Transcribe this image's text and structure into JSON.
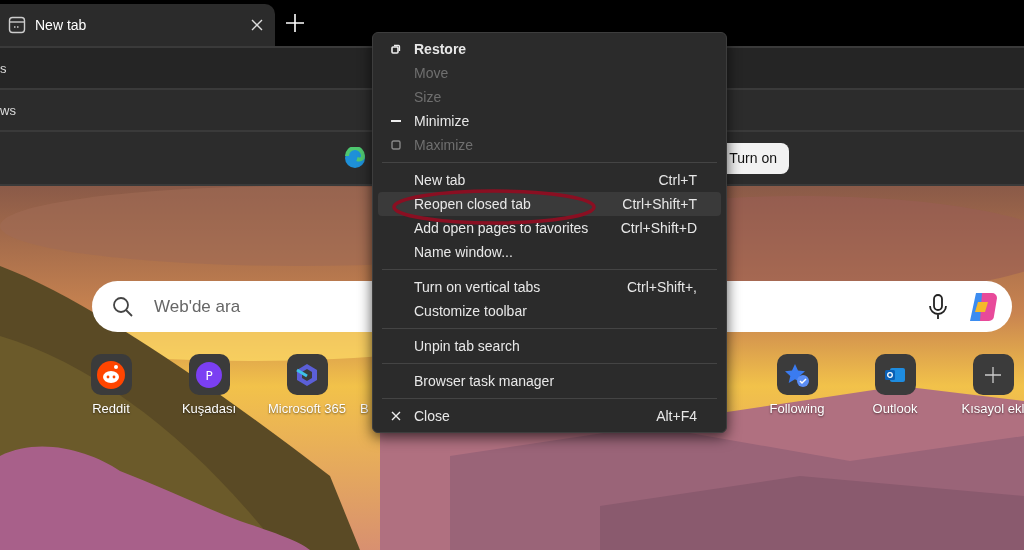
{
  "tabs": [
    {
      "label": "New tab",
      "selected": true
    }
  ],
  "panel": {
    "rows": [
      {
        "text": "s"
      },
      {
        "text": "ws"
      }
    ],
    "banner": {
      "button": "Turn on"
    }
  },
  "search": {
    "placeholder": "Web'de ara"
  },
  "shortcuts": [
    {
      "label": "Reddit",
      "kind": "reddit"
    },
    {
      "label": "Kuşadası",
      "kind": "letter",
      "letter": "P"
    },
    {
      "label": "Microsoft 365",
      "kind": "m365"
    },
    {
      "label": "B",
      "kind": "hidden"
    },
    {
      "kind": "gap"
    },
    {
      "kind": "gap"
    },
    {
      "kind": "gap"
    },
    {
      "label": "Following",
      "kind": "following"
    },
    {
      "label": "Outlook",
      "kind": "outlook"
    },
    {
      "label": "Kısayol ekl",
      "kind": "add"
    }
  ],
  "menu": {
    "groups": [
      [
        {
          "label": "Restore",
          "kind": "restore",
          "default": true,
          "disabled": false,
          "selected": false
        },
        {
          "label": "Move",
          "kind": "plain",
          "default": false,
          "disabled": true,
          "selected": false
        },
        {
          "label": "Size",
          "kind": "plain",
          "default": false,
          "disabled": true,
          "selected": false
        },
        {
          "label": "Minimize",
          "kind": "minimize",
          "default": false,
          "disabled": false,
          "selected": false
        },
        {
          "label": "Maximize",
          "kind": "maximize",
          "default": false,
          "disabled": true,
          "selected": false
        }
      ],
      [
        {
          "label": "New tab",
          "shortcut": "Ctrl+T",
          "kind": "plain",
          "default": false,
          "disabled": false,
          "selected": false
        },
        {
          "label": "Reopen closed tab",
          "shortcut": "Ctrl+Shift+T",
          "kind": "plain",
          "default": false,
          "disabled": false,
          "selected": true
        },
        {
          "label": "Add open pages to favorites",
          "shortcut": "Ctrl+Shift+D",
          "kind": "plain",
          "default": false,
          "disabled": false,
          "selected": false
        },
        {
          "label": "Name window...",
          "kind": "plain",
          "default": false,
          "disabled": false,
          "selected": false
        }
      ],
      [
        {
          "label": "Turn on vertical tabs",
          "shortcut": "Ctrl+Shift+,",
          "kind": "plain",
          "default": false,
          "disabled": false,
          "selected": false
        },
        {
          "label": "Customize toolbar",
          "kind": "plain",
          "default": false,
          "disabled": false,
          "selected": false
        }
      ],
      [
        {
          "label": "Unpin tab search",
          "kind": "plain",
          "default": false,
          "disabled": false,
          "selected": false
        }
      ],
      [
        {
          "label": "Browser task manager",
          "kind": "plain",
          "default": false,
          "disabled": false,
          "selected": false
        }
      ],
      [
        {
          "label": "Close",
          "shortcut": "Alt+F4",
          "kind": "close",
          "default": false,
          "disabled": false,
          "selected": false
        }
      ]
    ]
  }
}
